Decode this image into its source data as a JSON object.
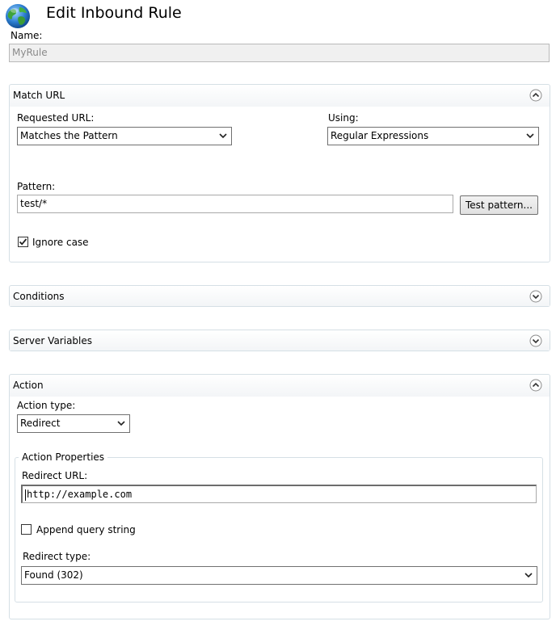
{
  "header": {
    "title": "Edit Inbound Rule"
  },
  "name": {
    "label": "Name:",
    "value": "MyRule"
  },
  "match_url": {
    "title": "Match URL",
    "requested_url_label": "Requested URL:",
    "requested_url_value": "Matches the Pattern",
    "using_label": "Using:",
    "using_value": "Regular Expressions",
    "pattern_label": "Pattern:",
    "pattern_value": "test/*",
    "test_pattern_button": "Test pattern...",
    "ignore_case_label": "Ignore case",
    "ignore_case_checked": true
  },
  "conditions": {
    "title": "Conditions"
  },
  "server_variables": {
    "title": "Server Variables"
  },
  "action": {
    "title": "Action",
    "action_type_label": "Action type:",
    "action_type_value": "Redirect",
    "properties_legend": "Action Properties",
    "redirect_url_label": "Redirect URL:",
    "redirect_url_value": "http://example.com",
    "append_query_label": "Append query string",
    "append_query_checked": false,
    "redirect_type_label": "Redirect type:",
    "redirect_type_value": "Found (302)"
  },
  "icons": {
    "globe": "globe-icon",
    "chevron_up": "chevron-up-circle-icon",
    "chevron_down": "chevron-down-circle-icon",
    "dropdown_arrow": "dropdown-arrow-icon",
    "check": "check-icon"
  }
}
